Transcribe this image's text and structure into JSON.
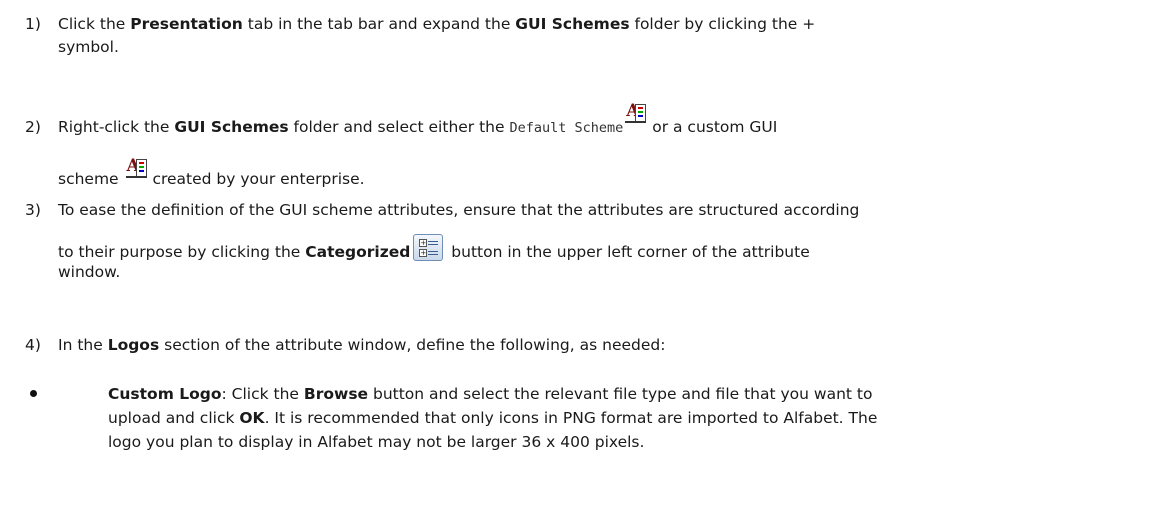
{
  "steps": [
    {
      "number": "1)",
      "parts": [
        "Click the ",
        "Presentation",
        " tab in the tab bar and expand the ",
        "GUI Schemes",
        " folder by clicking the +",
        "symbol."
      ]
    },
    {
      "number": "2)",
      "parts": [
        "Right-click the ",
        "GUI Schemes",
        " folder and select either the ",
        "Default Scheme",
        " or a custom GUI",
        "scheme ",
        " created by your enterprise."
      ]
    },
    {
      "number": "3)",
      "parts": [
        "To ease the definition of the GUI scheme attributes, ensure that the attributes are structured according",
        "to their purpose by clicking the ",
        "Categorized",
        " button in the upper left corner of the attribute",
        "window."
      ]
    },
    {
      "number": "4)",
      "parts": [
        "In the ",
        "Logos",
        " section of the attribute window, define the following, as needed:"
      ]
    }
  ],
  "bullet": {
    "parts": [
      "Custom Logo",
      ": Click the ",
      "Browse",
      " button and select the relevant file type and file that you want to",
      "upload and click ",
      "OK",
      ". It is recommended that only icons in PNG format are imported to Alfabet. The",
      "logo you plan to display in Alfabet may not be larger 36 x 400 pixels."
    ]
  },
  "icons": {
    "gui_scheme": "gui-scheme-icon",
    "categorized": "categorized-button-icon"
  }
}
